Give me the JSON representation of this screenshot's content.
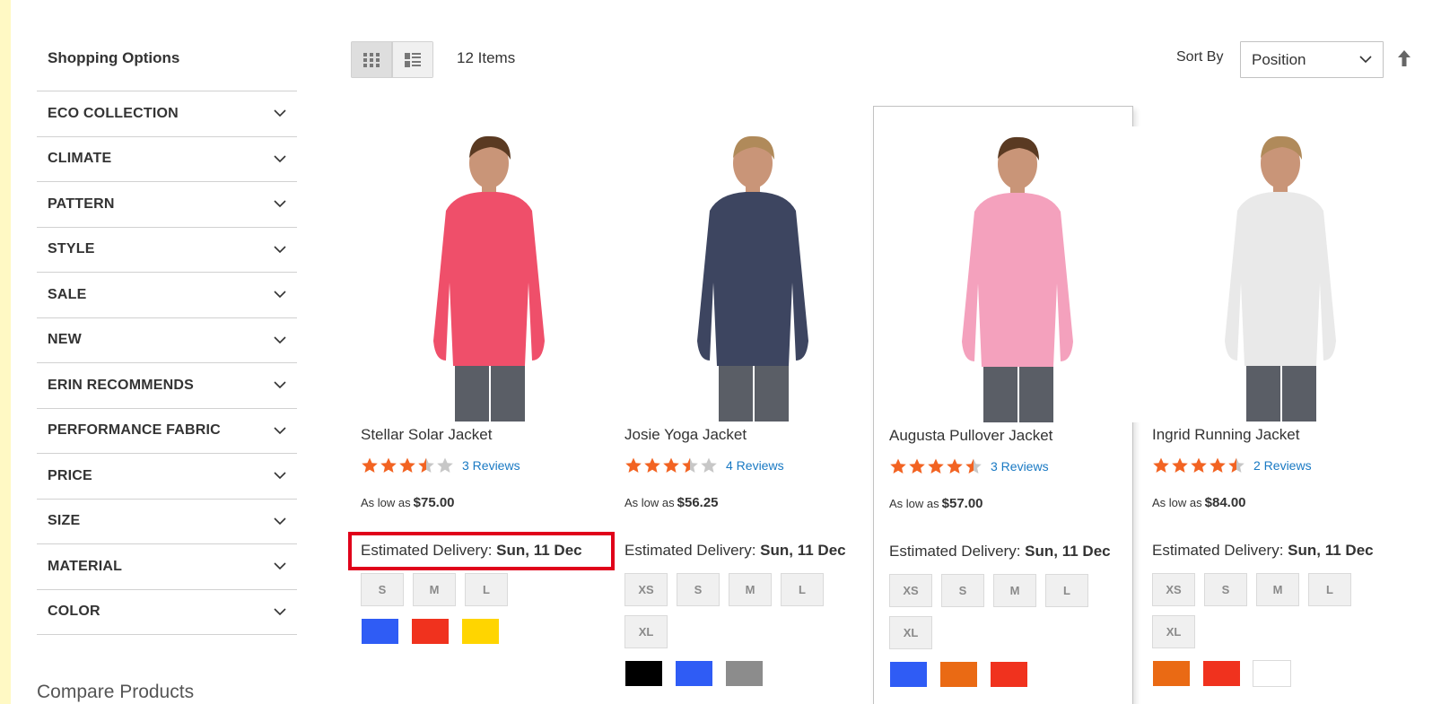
{
  "sidebar": {
    "title": "Shopping Options",
    "filters": [
      {
        "label": "ECO COLLECTION"
      },
      {
        "label": "CLIMATE"
      },
      {
        "label": "PATTERN"
      },
      {
        "label": "STYLE"
      },
      {
        "label": "SALE"
      },
      {
        "label": "NEW"
      },
      {
        "label": "ERIN RECOMMENDS"
      },
      {
        "label": "PERFORMANCE FABRIC"
      },
      {
        "label": "PRICE"
      },
      {
        "label": "SIZE"
      },
      {
        "label": "MATERIAL"
      },
      {
        "label": "COLOR"
      }
    ],
    "compare_title": "Compare Products"
  },
  "toolbar": {
    "items_count": "12 Items",
    "sort_label": "Sort By",
    "sort_value": "Position"
  },
  "colors": {
    "star": "#f26322",
    "link": "#1979c3",
    "highlight": "#e0001a"
  },
  "products": [
    {
      "name": "Stellar Solar Jacket",
      "rating": 3.5,
      "reviews": "3  Reviews",
      "price_prefix": "As low as",
      "price": "$75.00",
      "delivery_label": "Estimated Delivery:",
      "delivery_date": "Sun, 11 Dec",
      "sizes": [
        "S",
        "M",
        "L"
      ],
      "swatches": [
        "#2f5cf5",
        "#f0321e",
        "#ffd500"
      ],
      "garment_color": "#ef4f6a"
    },
    {
      "name": "Josie Yoga Jacket",
      "rating": 3.5,
      "reviews": "4  Reviews",
      "price_prefix": "As low as",
      "price": "$56.25",
      "delivery_label": "Estimated Delivery:",
      "delivery_date": "Sun, 11 Dec",
      "sizes": [
        "XS",
        "S",
        "M",
        "L",
        "XL"
      ],
      "swatches": [
        "#000000",
        "#2f5cf5",
        "#8c8c8c"
      ],
      "garment_color": "#3d4560"
    },
    {
      "name": "Augusta Pullover Jacket",
      "rating": 4.5,
      "reviews": "3  Reviews",
      "price_prefix": "As low as",
      "price": "$57.00",
      "delivery_label": "Estimated Delivery:",
      "delivery_date": "Sun, 11 Dec",
      "sizes": [
        "XS",
        "S",
        "M",
        "L",
        "XL"
      ],
      "swatches": [
        "#2f5cf5",
        "#ea6a14",
        "#f0321e"
      ],
      "garment_color": "#f4a1bd"
    },
    {
      "name": "Ingrid Running Jacket",
      "rating": 4.5,
      "reviews": "2  Reviews",
      "price_prefix": "As low as",
      "price": "$84.00",
      "delivery_label": "Estimated Delivery:",
      "delivery_date": "Sun, 11 Dec",
      "sizes": [
        "XS",
        "S",
        "M",
        "L",
        "XL"
      ],
      "swatches": [
        "#ea6a14",
        "#f0321e",
        "#ffffff"
      ],
      "garment_color": "#e9e9e9"
    }
  ]
}
